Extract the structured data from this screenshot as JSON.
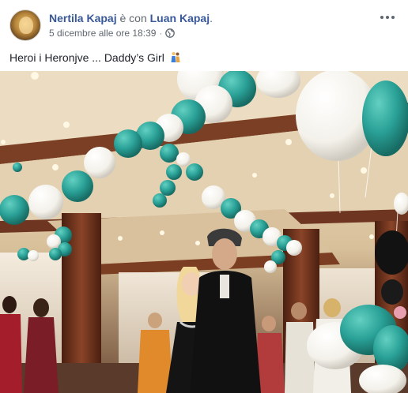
{
  "post": {
    "author_name": "Nertila Kapaj",
    "with_text": " è con ",
    "tagged_name": "Luan Kapaj",
    "tagged_suffix": ".",
    "timestamp": "5 dicembre alle ore 18:39",
    "separator": "·",
    "privacy_icon": "globe-icon",
    "caption": "Heroi i Heronjve ... Daddy’s Girl",
    "caption_emoji": "dancing-couple-emoji",
    "more_icon": "three-dots-icon"
  },
  "colors": {
    "link": "#385898",
    "secondary_text": "#606770",
    "balloon_teal": "#2aa197",
    "balloon_white": "#fbfbf7",
    "ceiling": "#e7d8bf",
    "wood": "#6e3520"
  }
}
